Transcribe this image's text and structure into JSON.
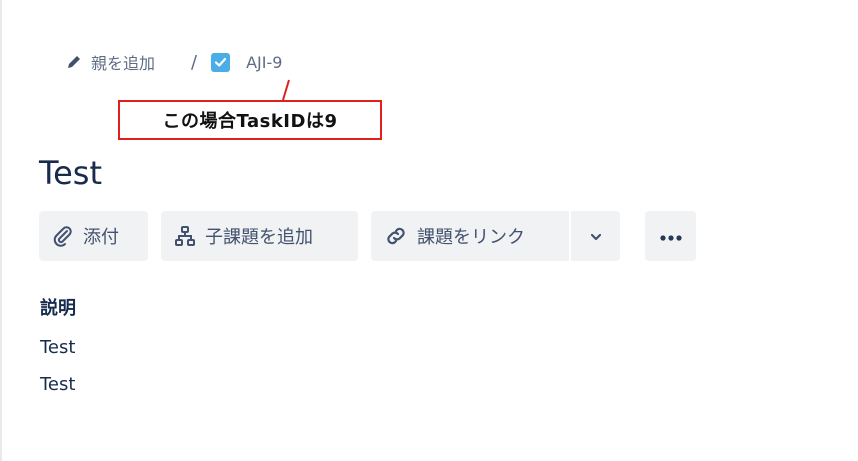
{
  "breadcrumb": {
    "add_parent_label": "親を追加",
    "separator": "/",
    "issue_key": "AJI-9"
  },
  "annotation": {
    "text": "この場合TaskIDは9",
    "color": "#e0201b"
  },
  "issue": {
    "title": "Test"
  },
  "toolbar": {
    "attach_label": "添付",
    "add_child_label": "子課題を追加",
    "link_issue_label": "課題をリンク"
  },
  "description": {
    "heading": "説明",
    "lines": [
      "Test",
      "Test"
    ]
  },
  "icons": {
    "parent": "pencil-icon",
    "issue_type": "checkbox-icon",
    "attach": "paperclip-icon",
    "child": "hierarchy-icon",
    "link": "link-icon",
    "dropdown": "chevron-down-icon",
    "more": "more-icon"
  },
  "colors": {
    "issue_type": "#4bade8",
    "button_bg": "#f1f2f4",
    "text": "#172b4d",
    "subtle_text": "#5e6c84"
  }
}
